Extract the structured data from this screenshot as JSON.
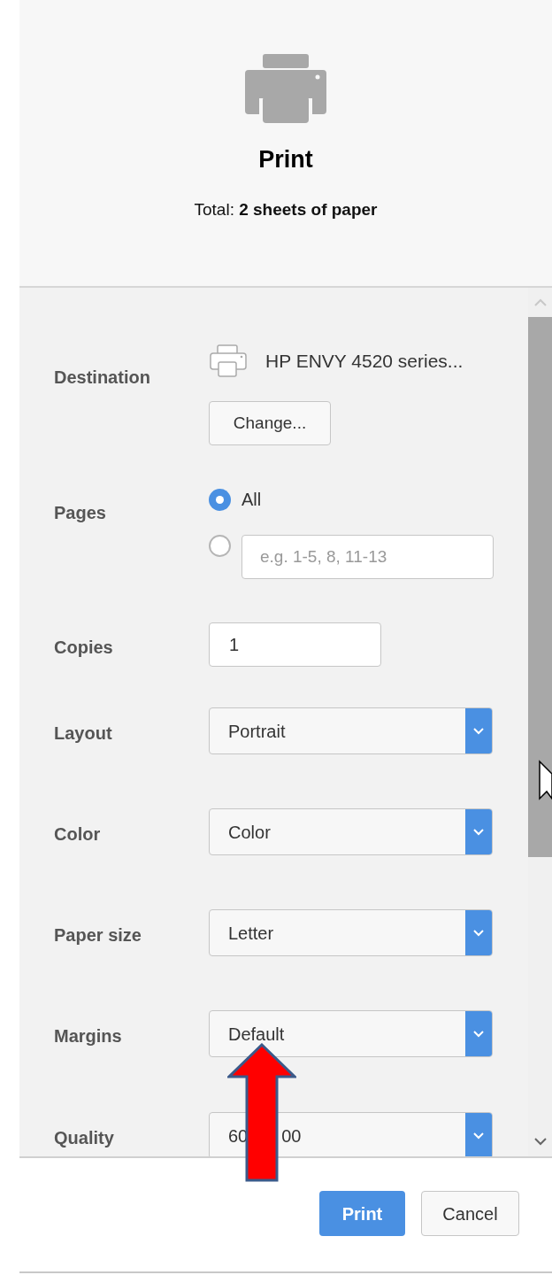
{
  "header": {
    "title": "Print",
    "summary": "Total: **2 sheets of paper**"
  },
  "settings": [
    {
      "kind": "destination",
      "label": "Destination",
      "printer": "HP ENVY 4520 series...",
      "button": "Change..."
    },
    {
      "kind": "pages",
      "label": "Pages",
      "options": [
        {
          "label": "All",
          "selected": true
        },
        {
          "placeholder": "e.g. 1-5, 8, 11-13",
          "selected": false
        }
      ]
    },
    {
      "kind": "number",
      "label": "Copies",
      "value": "1"
    },
    {
      "kind": "select",
      "label": "Layout",
      "value": "Portrait"
    },
    {
      "kind": "select",
      "label": "Color",
      "value": "Color"
    },
    {
      "kind": "select",
      "label": "Paper size",
      "value": "Letter"
    },
    {
      "kind": "select",
      "label": "Margins",
      "value": "Default"
    },
    {
      "kind": "select",
      "label": "Quality",
      "value": "60",
      "value_tail": "00"
    }
  ],
  "buttons": [
    {
      "label": "Print",
      "kind": "primary"
    },
    {
      "label": "Cancel",
      "kind": "secondary"
    }
  ]
}
